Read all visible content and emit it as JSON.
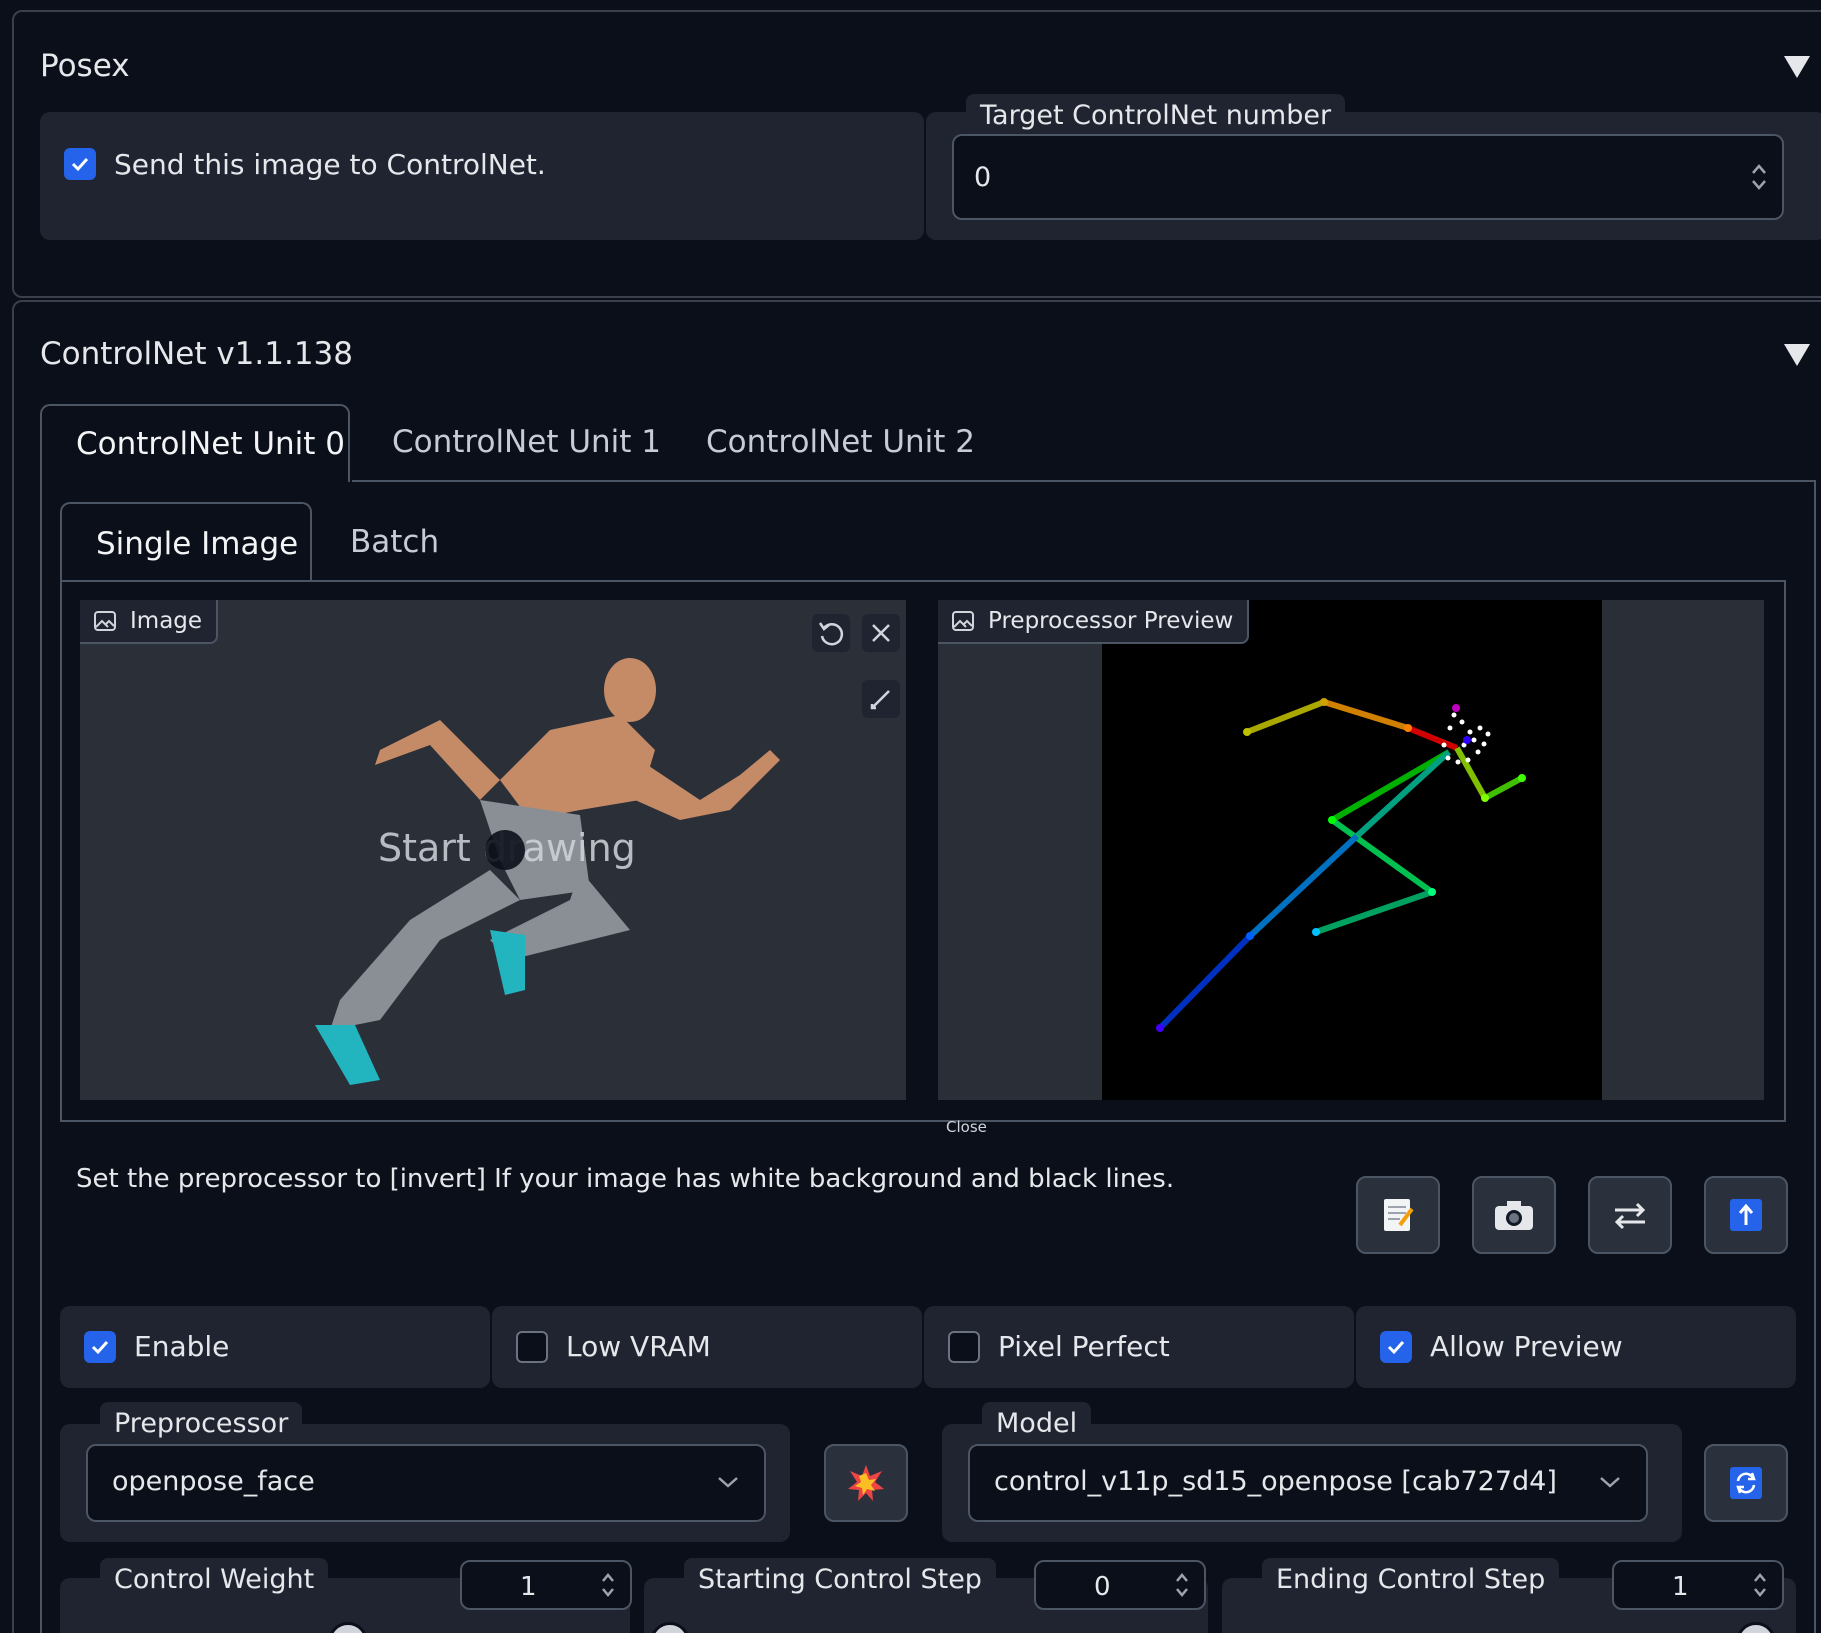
{
  "posex": {
    "title": "Posex",
    "send_label": "Send this image to ControlNet.",
    "send_checked": true,
    "target_label": "Target ControlNet number",
    "target_value": "0"
  },
  "controlnet": {
    "title": "ControlNet v1.1.138",
    "unit_tabs": [
      "ControlNet Unit 0",
      "ControlNet Unit 1",
      "ControlNet Unit 2"
    ],
    "mode_tabs": [
      "Single Image",
      "Batch"
    ],
    "image_label": "Image",
    "canvas_hint": "Start drawing",
    "preview_label": "Preprocessor Preview",
    "close_label": "Close",
    "hint_text": "Set the preprocessor to [invert] If your image has white background and black lines.",
    "options": [
      {
        "label": "Enable",
        "checked": true
      },
      {
        "label": "Low VRAM",
        "checked": false
      },
      {
        "label": "Pixel Perfect",
        "checked": false
      },
      {
        "label": "Allow Preview",
        "checked": true
      }
    ],
    "preprocessor_label": "Preprocessor",
    "preprocessor_value": "openpose_face",
    "model_label": "Model",
    "model_value": "control_v11p_sd15_openpose [cab727d4]",
    "control_weight_label": "Control Weight",
    "control_weight_value": "1",
    "control_weight_fraction": 0.5,
    "start_step_label": "Starting Control Step",
    "start_step_value": "0",
    "start_step_fraction": 0.0,
    "end_step_label": "Ending Control Step",
    "end_step_value": "1",
    "end_step_fraction": 1.0
  },
  "icons": {
    "accent": "#2563eb",
    "panel_bg": "#1f2430"
  }
}
